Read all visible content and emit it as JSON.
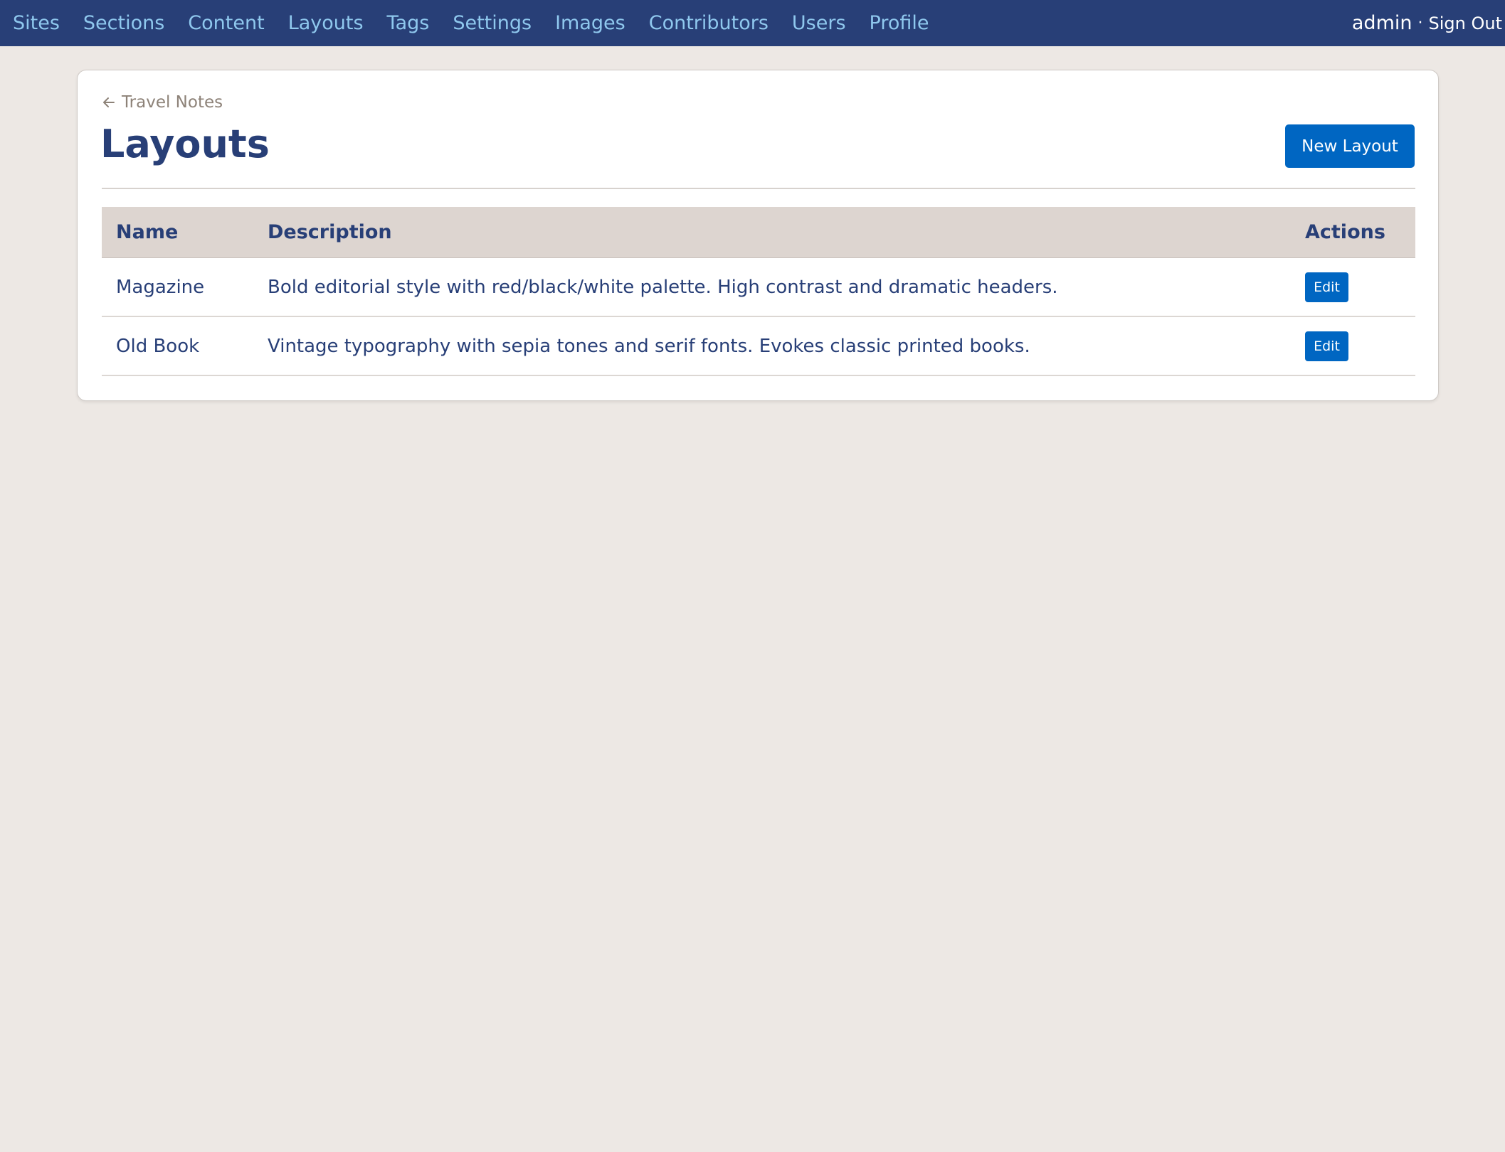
{
  "nav": {
    "items": [
      {
        "label": "Sites"
      },
      {
        "label": "Sections"
      },
      {
        "label": "Content"
      },
      {
        "label": "Layouts"
      },
      {
        "label": "Tags"
      },
      {
        "label": "Settings"
      },
      {
        "label": "Images"
      },
      {
        "label": "Contributors"
      },
      {
        "label": "Users"
      },
      {
        "label": "Profile"
      }
    ],
    "username": "admin",
    "separator": "·",
    "signout_label": "Sign Out"
  },
  "breadcrumb": {
    "label": "Travel Notes",
    "icon": "arrow-left-icon"
  },
  "page": {
    "title": "Layouts",
    "new_button_label": "New Layout"
  },
  "table": {
    "headers": {
      "name": "Name",
      "description": "Description",
      "actions": "Actions"
    },
    "rows": [
      {
        "name": "Magazine",
        "description": "Bold editorial style with red/black/white palette. High contrast and dramatic headers.",
        "action_label": "Edit"
      },
      {
        "name": "Old Book",
        "description": "Vintage typography with sepia tones and serif fonts. Evokes classic printed books.",
        "action_label": "Edit"
      }
    ]
  },
  "colors": {
    "topbar": "#283f77",
    "nav_link": "#8fc8ee",
    "primary_button": "#0066c2",
    "background": "#ede8e4",
    "table_header": "#ddd5d0",
    "text": "#283f77"
  }
}
